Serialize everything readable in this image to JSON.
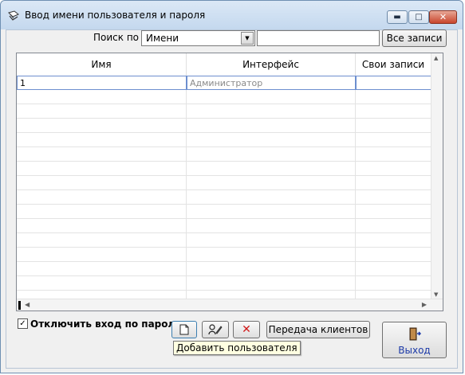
{
  "window": {
    "title": "Ввод имени пользователя и пароля",
    "minimize_glyph": "▬",
    "maximize_glyph": "□",
    "close_glyph": "✕"
  },
  "search": {
    "label": "Поиск по",
    "field_selected": "Имени",
    "value": "",
    "all_records_button": "Все записи"
  },
  "grid": {
    "columns": [
      "Имя",
      "Интерфейс",
      "Свои записи"
    ],
    "rows": [
      [
        "1",
        "Администратор",
        ""
      ],
      [
        "",
        "",
        ""
      ],
      [
        "",
        "",
        ""
      ],
      [
        "",
        "",
        ""
      ],
      [
        "",
        "",
        ""
      ],
      [
        "",
        "",
        ""
      ],
      [
        "",
        "",
        ""
      ],
      [
        "",
        "",
        ""
      ],
      [
        "",
        "",
        ""
      ],
      [
        "",
        "",
        ""
      ],
      [
        "",
        "",
        ""
      ],
      [
        "",
        "",
        ""
      ],
      [
        "",
        "",
        ""
      ],
      [
        "",
        "",
        ""
      ],
      [
        "",
        "",
        ""
      ],
      [
        "",
        "",
        ""
      ]
    ]
  },
  "options": {
    "disable_password_label": "Отключить вход по паролю",
    "disable_password_checked": true,
    "check_glyph": "✓"
  },
  "toolbar": {
    "add_icon": "new-document-icon",
    "edit_icon": "edit-user-icon",
    "delete_icon": "delete-x-icon",
    "delete_glyph": "✕",
    "transfer_clients_button": "Передача клиентов",
    "tooltip": "Добавить пользователя"
  },
  "exit": {
    "label": "Выход",
    "icon": "exit-door-icon"
  },
  "colors": {
    "delete_red": "#d01818",
    "exit_label_blue": "#1c3aa8",
    "selection_border": "#6d8fcf"
  }
}
